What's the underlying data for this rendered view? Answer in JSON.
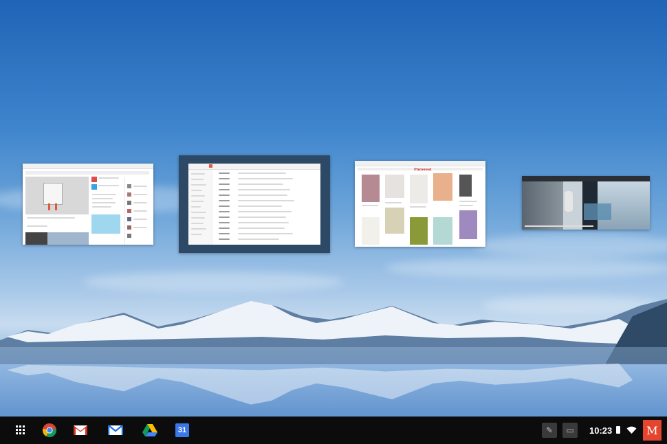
{
  "windows": [
    {
      "name": "google-plus-window",
      "app": "Google+"
    },
    {
      "name": "inbox-window",
      "app": "Inbox",
      "selected": true
    },
    {
      "name": "pinterest-window",
      "app": "Pinterest",
      "logo": "Pinterest"
    },
    {
      "name": "video-window",
      "app": "Video"
    }
  ],
  "shelf": {
    "apps": [
      {
        "name": "launcher-icon"
      },
      {
        "name": "chrome-icon"
      },
      {
        "name": "gmail-icon"
      },
      {
        "name": "inbox-icon"
      },
      {
        "name": "drive-icon"
      },
      {
        "name": "calendar-icon",
        "label": "31"
      }
    ],
    "tray": {
      "pen_icon": "pen-icon",
      "ime_icon": "message-icon",
      "time": "10:23",
      "battery_icon": "battery-icon",
      "wifi_icon": "wifi-icon",
      "avatar_letter": "M"
    }
  },
  "colors": {
    "shelf": "#0c0c0d",
    "selected_frame": "#2d4966",
    "avatar": "#e4452f",
    "pinterest": "#cb2027"
  }
}
